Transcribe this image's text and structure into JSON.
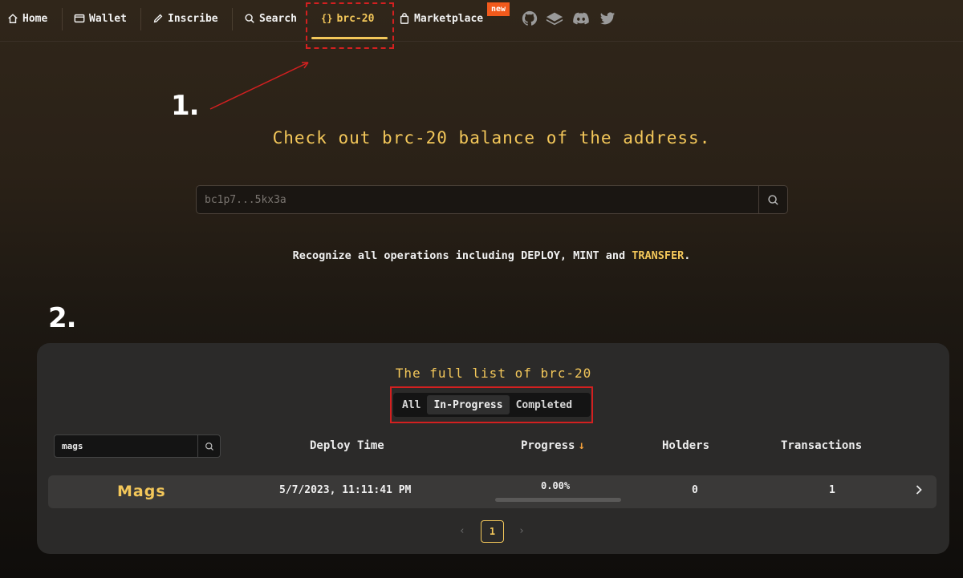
{
  "nav": {
    "items": [
      {
        "label": "Home",
        "icon": "home-icon"
      },
      {
        "label": "Wallet",
        "icon": "wallet-icon"
      },
      {
        "label": "Inscribe",
        "icon": "pencil-icon"
      },
      {
        "label": "Search",
        "icon": "search-icon"
      },
      {
        "label": "brc-20",
        "icon": "braces-icon",
        "active": true
      },
      {
        "label": "Marketplace",
        "icon": "bag-icon"
      }
    ],
    "new_badge": "new",
    "socials": [
      "github-icon",
      "gitbook-icon",
      "discord-icon",
      "twitter-icon"
    ]
  },
  "annotations": {
    "step1": "1.",
    "step2": "2."
  },
  "hero": {
    "title": "Check out brc-20 balance of the address.",
    "search_placeholder": "bc1p7...5kx3a",
    "sub_prefix": "Recognize all operations including DEPLOY, MINT and ",
    "sub_highlight": "TRANSFER",
    "sub_suffix": "."
  },
  "list": {
    "title": "The full list of brc-20",
    "tabs": [
      {
        "label": "All"
      },
      {
        "label": "In-Progress",
        "active": true
      },
      {
        "label": "Completed"
      }
    ],
    "filter_value": "mags",
    "columns": {
      "deploy_time": "Deploy Time",
      "progress": "Progress",
      "holders": "Holders",
      "transactions": "Transactions"
    },
    "rows": [
      {
        "tick": "Mags",
        "deploy_time": "5/7/2023, 11:11:41 PM",
        "progress": "0.00%",
        "progress_fraction": 0.0,
        "holders": "0",
        "transactions": "1"
      }
    ],
    "pagination": {
      "current": "1",
      "prev": "‹",
      "next": "›"
    }
  },
  "colors": {
    "accent": "#f3c75a",
    "annotation": "#d32020",
    "badge": "#f25a1c"
  }
}
